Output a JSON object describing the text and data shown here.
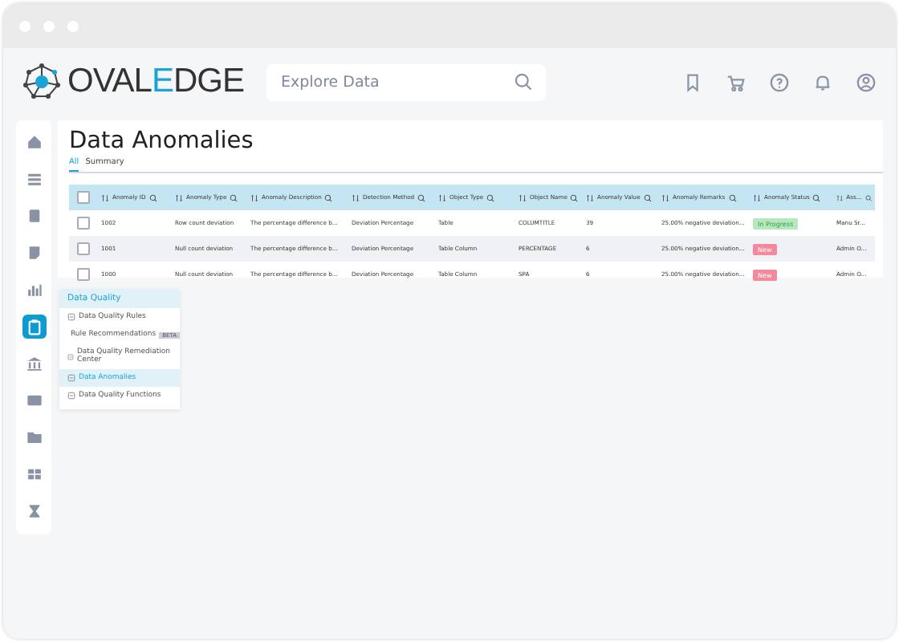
{
  "header": {
    "logo": [
      {
        "text": "OVAL",
        "accent": false
      },
      {
        "text": "E",
        "accent": true
      },
      {
        "text": "DGE",
        "accent": false
      }
    ],
    "search": {
      "placeholder": "Explore Data"
    },
    "icons": [
      {
        "kind": "bookmark"
      },
      {
        "kind": "cart"
      },
      {
        "kind": "help"
      },
      {
        "kind": "bell"
      },
      {
        "kind": "user"
      }
    ]
  },
  "rail": [
    {
      "kind": "home",
      "selected": false
    },
    {
      "kind": "list",
      "selected": false
    },
    {
      "kind": "doc",
      "selected": false
    },
    {
      "kind": "page",
      "selected": false
    },
    {
      "kind": "chart",
      "selected": false
    },
    {
      "kind": "clipboard",
      "selected": true
    },
    {
      "kind": "bank",
      "selected": false
    },
    {
      "kind": "card",
      "selected": false
    },
    {
      "kind": "folder",
      "selected": false
    },
    {
      "kind": "grid",
      "selected": false
    },
    {
      "kind": "hourglass",
      "selected": false
    }
  ],
  "page": {
    "title": "Data Anomalies",
    "tabs": [
      {
        "label": "All",
        "selected": true
      },
      {
        "label": "Summary",
        "selected": false
      }
    ]
  },
  "table": {
    "header_checked": false,
    "columns": [
      "Anomaly ID",
      "Anomaly Type",
      "Anomaly Description",
      "Detection Method",
      "Object Type",
      "Object Name",
      "Anomaly Value",
      "Anomaly Remarks",
      "Anomaly Status",
      "Ass..."
    ],
    "rows": [
      {
        "checked": false,
        "cells": [
          "1002",
          "Row count deviation",
          "The percentage difference b...",
          "Deviation Percentage",
          "Table",
          "COLUMTITLE",
          "39",
          "25.00% negative deviation...",
          "Manu Sr..."
        ],
        "status": {
          "text": "In Progress",
          "kind": "progress"
        }
      },
      {
        "checked": false,
        "cells": [
          "1001",
          "Null count deviation",
          "The percentage difference b...",
          "Deviation Percentage",
          "Table Column",
          "PERCENTAGE",
          "6",
          "25.00% negative deviation...",
          "Admin O..."
        ],
        "status": {
          "text": "New",
          "kind": "new"
        }
      },
      {
        "checked": false,
        "cells": [
          "1000",
          "Null count deviation",
          "The percentage difference b...",
          "Deviation Percentage",
          "Table Column",
          "SPA",
          "6",
          "25.00% negative deviation...",
          "Admin O..."
        ],
        "status": {
          "text": "New",
          "kind": "new"
        }
      }
    ]
  },
  "menu": {
    "title": "Data Quality",
    "items": [
      {
        "label": "Data Quality Rules",
        "selected": false
      },
      {
        "label": "Rule Recommendations",
        "selected": false,
        "badge": "BETA"
      },
      {
        "label": "Data Quality Remediation Center",
        "selected": false
      },
      {
        "label": "Data Anomalies",
        "selected": true
      },
      {
        "label": "Data Quality Functions",
        "selected": false
      }
    ]
  }
}
